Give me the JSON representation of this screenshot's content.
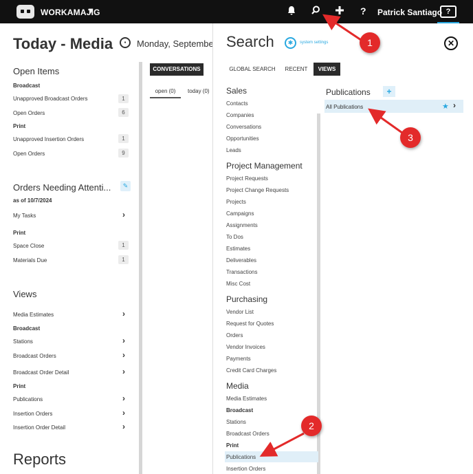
{
  "topbar": {
    "app_name": "WORKAMAJIG",
    "user_name": "Patrick Santiago",
    "help_label": "?",
    "icons": [
      "bell-icon",
      "search-icon",
      "plus-icon",
      "question-icon"
    ]
  },
  "left": {
    "title": "Today - Media",
    "open_items": {
      "heading": "Open Items",
      "groups": [
        {
          "label": "Broadcast",
          "rows": [
            {
              "label": "Unapproved Broadcast Orders",
              "count": "1"
            },
            {
              "label": "Open Orders",
              "count": "6"
            }
          ]
        },
        {
          "label": "Print",
          "rows": [
            {
              "label": "Unapproved Insertion Orders",
              "count": "1"
            },
            {
              "label": "Open Orders",
              "count": "9"
            }
          ]
        }
      ]
    },
    "orders_needing": {
      "heading": "Orders Needing Attenti...",
      "as_of": "as of 10/7/2024",
      "my_tasks": "My Tasks",
      "print_label": "Print",
      "rows": [
        {
          "label": "Space Close",
          "count": "1"
        },
        {
          "label": "Materials Due",
          "count": "1"
        }
      ]
    },
    "views": {
      "heading": "Views",
      "media_estimates": "Media Estimates",
      "broadcast_label": "Broadcast",
      "broadcast_items": [
        "Stations",
        "Broadcast Orders",
        "Broadcast Order Detail"
      ],
      "print_label": "Print",
      "print_items": [
        "Publications",
        "Insertion Orders",
        "Insertion Order Detail"
      ]
    },
    "reports_heading": "Reports"
  },
  "middle": {
    "date_text": "Monday, September",
    "conversations_tab": "CONVERSATIONS",
    "open_tab": "open (0)",
    "today_tab": "today (0)"
  },
  "search": {
    "title": "Search",
    "system_settings": "system settings",
    "tabs": {
      "global": "GLOBAL SEARCH",
      "recent": "RECENT",
      "views": "VIEWS"
    },
    "categories": {
      "sales": {
        "heading": "Sales",
        "items": [
          "Contacts",
          "Companies",
          "Conversations",
          "Opportunities",
          "Leads"
        ]
      },
      "project_management": {
        "heading": "Project Management",
        "items": [
          "Project Requests",
          "Project Change Requests",
          "Projects",
          "Campaigns",
          "Assignments",
          "To Dos",
          "Estimates",
          "Deliverables",
          "Transactions",
          "Misc Cost"
        ]
      },
      "purchasing": {
        "heading": "Purchasing",
        "items": [
          "Vendor List",
          "Request for Quotes",
          "Orders",
          "Vendor Invoices",
          "Payments",
          "Credit Card Charges"
        ]
      },
      "media": {
        "heading": "Media",
        "items_top": [
          "Media Estimates"
        ],
        "broadcast_label": "Broadcast",
        "broadcast_items": [
          "Stations",
          "Broadcast Orders"
        ],
        "print_label": "Print",
        "print_items": [
          "Publications",
          "Insertion Orders"
        ]
      }
    },
    "results": {
      "heading": "Publications",
      "items": [
        "All Publications"
      ]
    }
  },
  "annotations": {
    "callouts": [
      "1",
      "2",
      "3"
    ],
    "color": "#e32a2a"
  },
  "colors": {
    "accent": "#29a8e0",
    "topbar": "#111111",
    "highlight": "#e0eff8"
  }
}
